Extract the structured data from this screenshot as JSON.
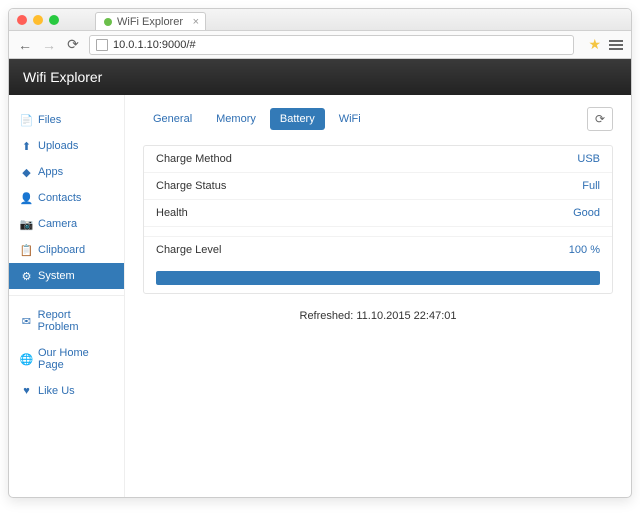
{
  "browser": {
    "tab_title": "WiFi Explorer",
    "url": "10.0.1.10:9000/#"
  },
  "header": {
    "title": "Wifi Explorer"
  },
  "sidebar": {
    "items": [
      {
        "icon": "file-icon",
        "label": "Files"
      },
      {
        "icon": "upload-icon",
        "label": "Uploads"
      },
      {
        "icon": "apps-icon",
        "label": "Apps"
      },
      {
        "icon": "contacts-icon",
        "label": "Contacts"
      },
      {
        "icon": "camera-icon",
        "label": "Camera"
      },
      {
        "icon": "clipboard-icon",
        "label": "Clipboard"
      },
      {
        "icon": "system-icon",
        "label": "System"
      },
      {
        "icon": "report-icon",
        "label": "Report Problem"
      },
      {
        "icon": "home-icon",
        "label": "Our Home Page"
      },
      {
        "icon": "like-icon",
        "label": "Like Us"
      }
    ]
  },
  "tabs": {
    "items": [
      "General",
      "Memory",
      "Battery",
      "WiFi"
    ],
    "active": "Battery"
  },
  "battery": {
    "rows": [
      {
        "label": "Charge Method",
        "value": "USB"
      },
      {
        "label": "Charge Status",
        "value": "Full"
      },
      {
        "label": "Health",
        "value": "Good"
      }
    ],
    "level": {
      "label": "Charge Level",
      "value": "100 %",
      "percent": 100
    }
  },
  "refreshed": {
    "label": "Refreshed:",
    "timestamp": "11.10.2015 22:47:01"
  }
}
